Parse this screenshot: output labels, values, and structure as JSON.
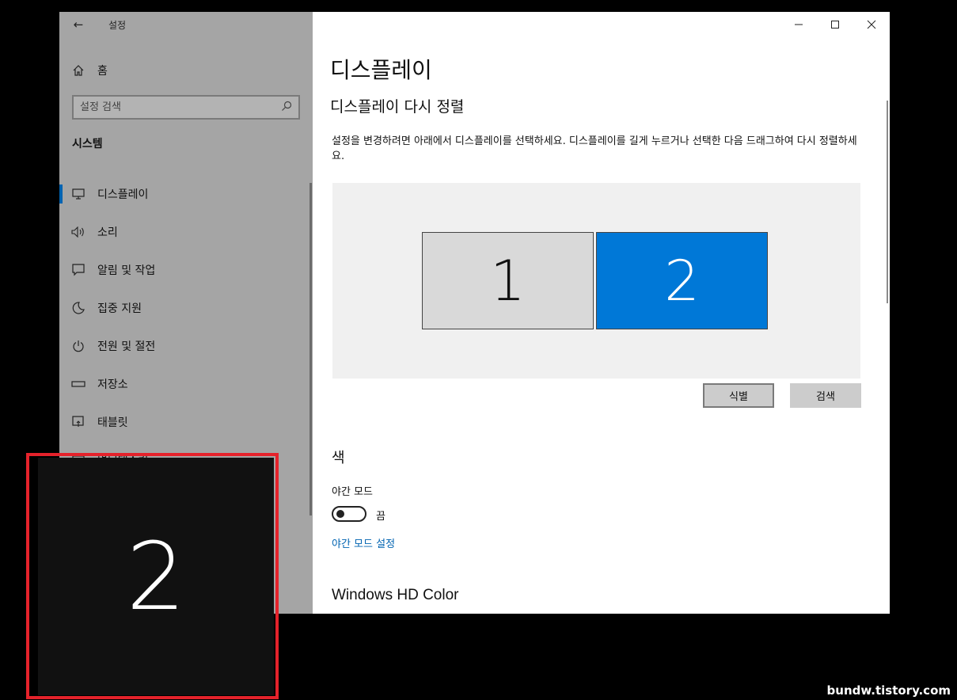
{
  "window": {
    "app_title": "설정",
    "controls": {
      "minimize": "—",
      "maximize": "☐",
      "close": "✕"
    }
  },
  "sidebar": {
    "home_label": "홈",
    "search_placeholder": "설정 검색",
    "section_heading": "시스템",
    "items": [
      {
        "label": "디스플레이",
        "icon": "monitor-icon",
        "active": true
      },
      {
        "label": "소리",
        "icon": "speaker-icon",
        "active": false
      },
      {
        "label": "알림 및 작업",
        "icon": "notification-icon",
        "active": false
      },
      {
        "label": "집중 지원",
        "icon": "moon-icon",
        "active": false
      },
      {
        "label": "전원 및 절전",
        "icon": "power-icon",
        "active": false
      },
      {
        "label": "저장소",
        "icon": "storage-icon",
        "active": false
      },
      {
        "label": "태블릿",
        "icon": "tablet-icon",
        "active": false
      },
      {
        "label": "멀티태스킹",
        "icon": "multitasking-icon",
        "active": false
      }
    ]
  },
  "main": {
    "page_title": "디스플레이",
    "sub_title": "디스플레이 다시 정렬",
    "instruction": "설정을 변경하려면 아래에서 디스플레이를 선택하세요. 디스플레이를 길게 누르거나 선택한 다음 드래그하여 다시 정렬하세요.",
    "monitors": [
      {
        "number": "1",
        "selected": false
      },
      {
        "number": "2",
        "selected": true
      }
    ],
    "identify_button": "식별",
    "detect_button": "검색",
    "color_heading": "색",
    "night_mode_label": "야간 모드",
    "night_mode_state": "끔",
    "night_mode_settings_link": "야간 모드 설정",
    "hd_color_heading": "Windows HD Color"
  },
  "identify_overlay": {
    "number": "2"
  },
  "watermark": "bundw.tistory.com",
  "colors": {
    "accent": "#0078d7",
    "sidebar_bg": "#a5a5a5",
    "highlight": "#e5222b",
    "link": "#0063b1"
  }
}
